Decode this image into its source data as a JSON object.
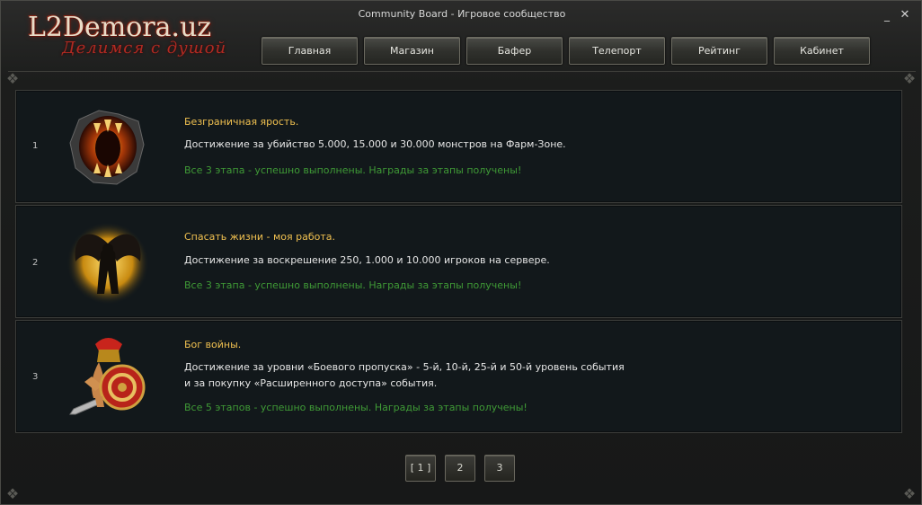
{
  "window": {
    "title": "Community Board - Игровое сообщество",
    "minimize_glyph": "_",
    "close_glyph": "✕"
  },
  "logo": {
    "main": "L2Demora.uz",
    "sub": "Делимся с душой"
  },
  "nav": [
    {
      "label": "Главная"
    },
    {
      "label": "Магазин"
    },
    {
      "label": "Бафер"
    },
    {
      "label": "Телепорт"
    },
    {
      "label": "Рейтинг"
    },
    {
      "label": "Кабинет"
    }
  ],
  "achievements": [
    {
      "num": "1",
      "icon": "fiery-maw-icon",
      "title": "Безграничная ярость.",
      "desc_lines": [
        "Достижение за убийство 5.000, 15.000 и 30.000 монстров на Фарм-Зоне."
      ],
      "status": "Все 3 этапа - успешно выполнены. Награды за этапы получены!"
    },
    {
      "num": "2",
      "icon": "winged-saviour-icon",
      "title": "Спасать жизни - моя работа.",
      "desc_lines": [
        "Достижение за воскрешение 250, 1.000 и 10.000 игроков на сервере."
      ],
      "status": "Все 3 этапа - успешно выполнены. Награды за этапы получены!"
    },
    {
      "num": "3",
      "icon": "spartan-warrior-icon",
      "title": "Бог войны.",
      "desc_lines": [
        "Достижение за уровни «Боевого пропуска» - 5-й, 10-й, 25-й и 50-й уровень события",
        "и за покупку «Расширенного доступа» события."
      ],
      "status": "Все 5 этапов - успешно выполнены. Награды за этапы получены!"
    }
  ],
  "pagination": [
    {
      "label": "[ 1 ]",
      "current": true
    },
    {
      "label": "2",
      "current": false
    },
    {
      "label": "3",
      "current": false
    }
  ],
  "colors": {
    "title": "#f0c050",
    "status": "#3f9a36",
    "text": "#e6e6e6"
  }
}
